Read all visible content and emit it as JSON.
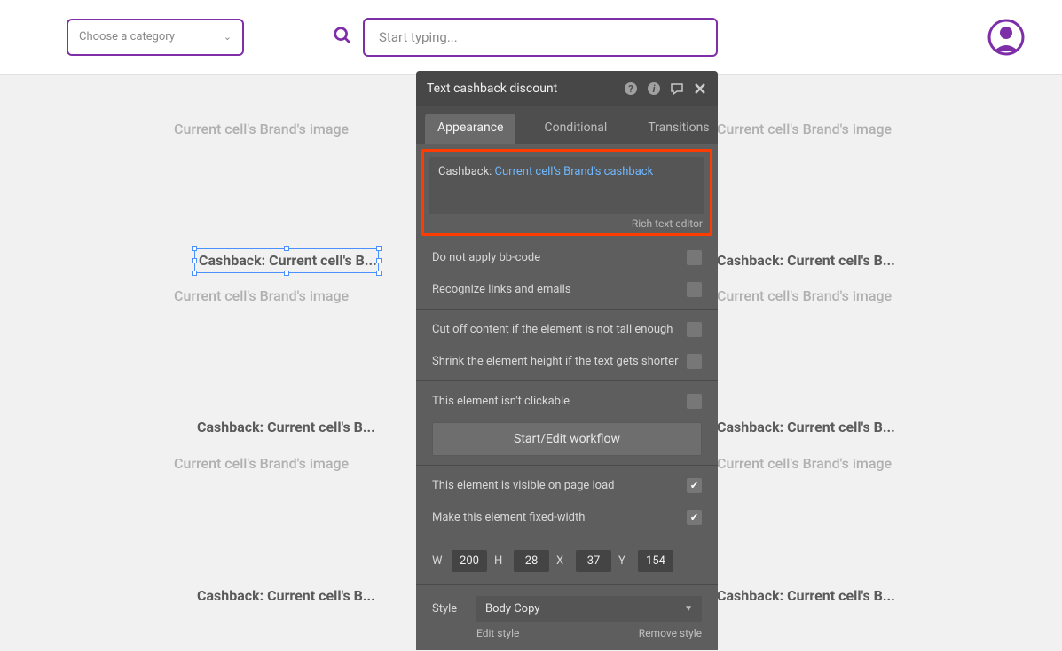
{
  "topbar": {
    "category_placeholder": "Choose a category",
    "search_placeholder": "Start typing..."
  },
  "canvas": {
    "brand_image_text": "Current cell's Brand's image",
    "cashback_text": "Cashback: Current cell's B..."
  },
  "panel": {
    "title": "Text cashback discount",
    "tabs": {
      "appearance": "Appearance",
      "conditional": "Conditional",
      "transitions": "Transitions"
    },
    "editor": {
      "prefix": "Cashback: ",
      "dynamic": "Current cell's Brand's cashback",
      "rich_label": "Rich text editor"
    },
    "options": {
      "no_bbcode": "Do not apply bb-code",
      "recognize_links": "Recognize links and emails",
      "cut_off": "Cut off content if the element is not tall enough",
      "shrink": "Shrink the element height if the text gets shorter",
      "not_clickable": "This element isn't clickable",
      "workflow": "Start/Edit workflow",
      "visible_load": "This element is visible on page load",
      "fixed_width": "Make this element fixed-width"
    },
    "dims": {
      "w_label": "W",
      "w": "200",
      "h_label": "H",
      "h": "28",
      "x_label": "X",
      "x": "37",
      "y_label": "Y",
      "y": "154"
    },
    "style": {
      "label": "Style",
      "value": "Body Copy",
      "edit": "Edit style",
      "remove": "Remove style"
    }
  }
}
